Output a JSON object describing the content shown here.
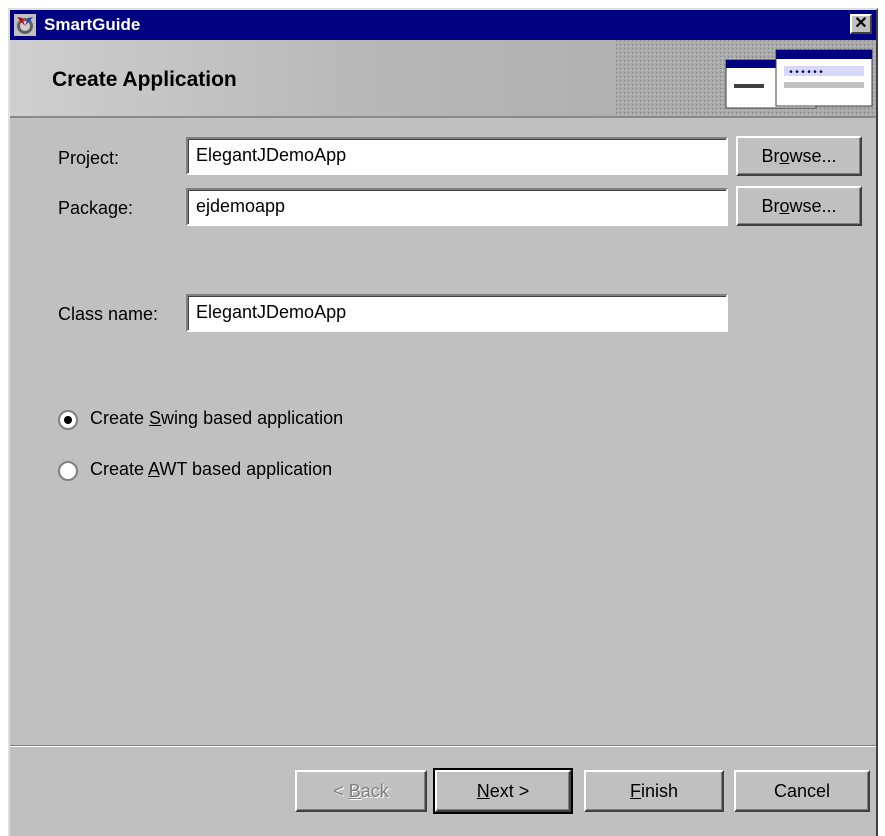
{
  "window": {
    "title": "SmartGuide",
    "close_symbol": "✕"
  },
  "header": {
    "title": "Create Application"
  },
  "form": {
    "project": {
      "label": "Project:",
      "value": "ElegantJDemoApp"
    },
    "package": {
      "label": "Package:",
      "value": "ejdemoapp"
    },
    "class_name": {
      "label": "Class name:",
      "value": "ElegantJDemoApp"
    },
    "browse_label_pre": "Br",
    "browse_label_u": "o",
    "browse_label_post": "wse...",
    "options": [
      {
        "pre": "Create ",
        "u": "S",
        "post": "wing based application",
        "selected": true
      },
      {
        "pre": "Create ",
        "u": "A",
        "post": "WT based application",
        "selected": false
      }
    ]
  },
  "footer": {
    "back": {
      "pre": "< ",
      "u": "B",
      "post": "ack"
    },
    "next": {
      "pre": "",
      "u": "N",
      "post": "ext >"
    },
    "finish": {
      "pre": "",
      "u": "F",
      "post": "inish"
    },
    "cancel": "Cancel"
  },
  "colors": {
    "titlebar": "#000080",
    "face": "#c0c0c0",
    "field": "#ffffff"
  }
}
